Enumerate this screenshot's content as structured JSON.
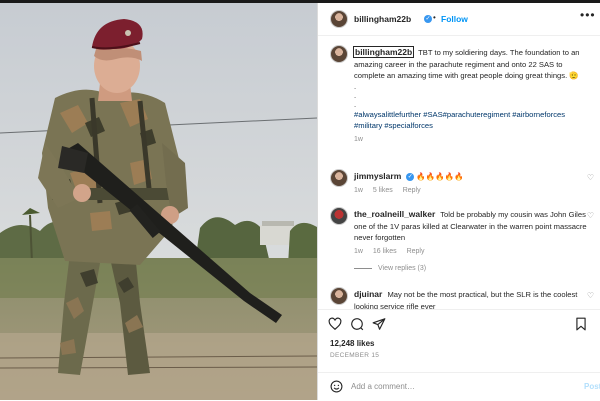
{
  "post": {
    "username": "billingham22b",
    "follow_label": "Follow",
    "dot": "•",
    "more": "•••"
  },
  "caption": {
    "username": "billingham22b",
    "text": "TBT to my soldiering days. The foundation to an amazing career in the parachute regiment and onto 22 SAS to complete an amazing time with great people doing great things. 🫡",
    "dots": ".\n.\n.",
    "hashtags": "#alwaysalittlefurther #SAS#parachuteregiment #airborneforces #military #specialforces",
    "time": "1w"
  },
  "comments": [
    {
      "username": "jimmyslarm",
      "text": "🔥🔥🔥🔥🔥",
      "time": "1w",
      "likes": "5 likes",
      "reply": "Reply",
      "verified": true
    },
    {
      "username": "the_roalneill_walker",
      "text": "Told be probably my cousin was John Giles one of the 1V paras killed at Clearwater in the warren point massacre never forgotten",
      "time": "1w",
      "likes": "16 likes",
      "reply": "Reply",
      "view_replies": "View replies (3)"
    },
    {
      "username": "djuinar",
      "text": "May not be the most practical, but the SLR is the coolest looking service rifle ever"
    }
  ],
  "likes": "12,248 likes",
  "date": "DECEMBER 15",
  "add_comment_placeholder": "Add a comment…",
  "post_label": "Post",
  "colors": {
    "link_blue": "#0095f6",
    "hashtag": "#00376b",
    "verified": "#3897f0",
    "muted": "#8e8e8e"
  }
}
